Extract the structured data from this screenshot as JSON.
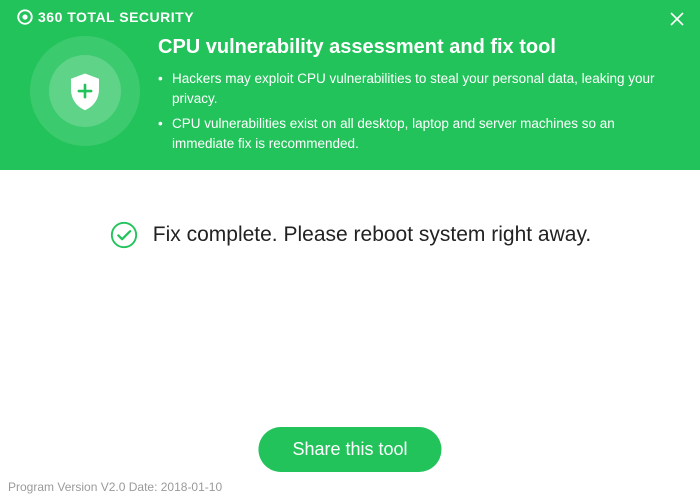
{
  "brand": "360 TOTAL SECURITY",
  "header": {
    "title": "CPU vulnerability assessment and fix tool",
    "bullets": [
      "Hackers may exploit CPU vulnerabilities to steal your personal data, leaking your privacy.",
      "CPU vulnerabilities exist on all desktop, laptop and server machines so an immediate fix is recommended."
    ]
  },
  "status": {
    "message": "Fix complete. Please reboot system right away."
  },
  "actions": {
    "share_label": "Share this tool"
  },
  "footer": {
    "version_text": "Program Version V2.0 Date: 2018-01-10"
  },
  "colors": {
    "primary": "#22c35a"
  }
}
